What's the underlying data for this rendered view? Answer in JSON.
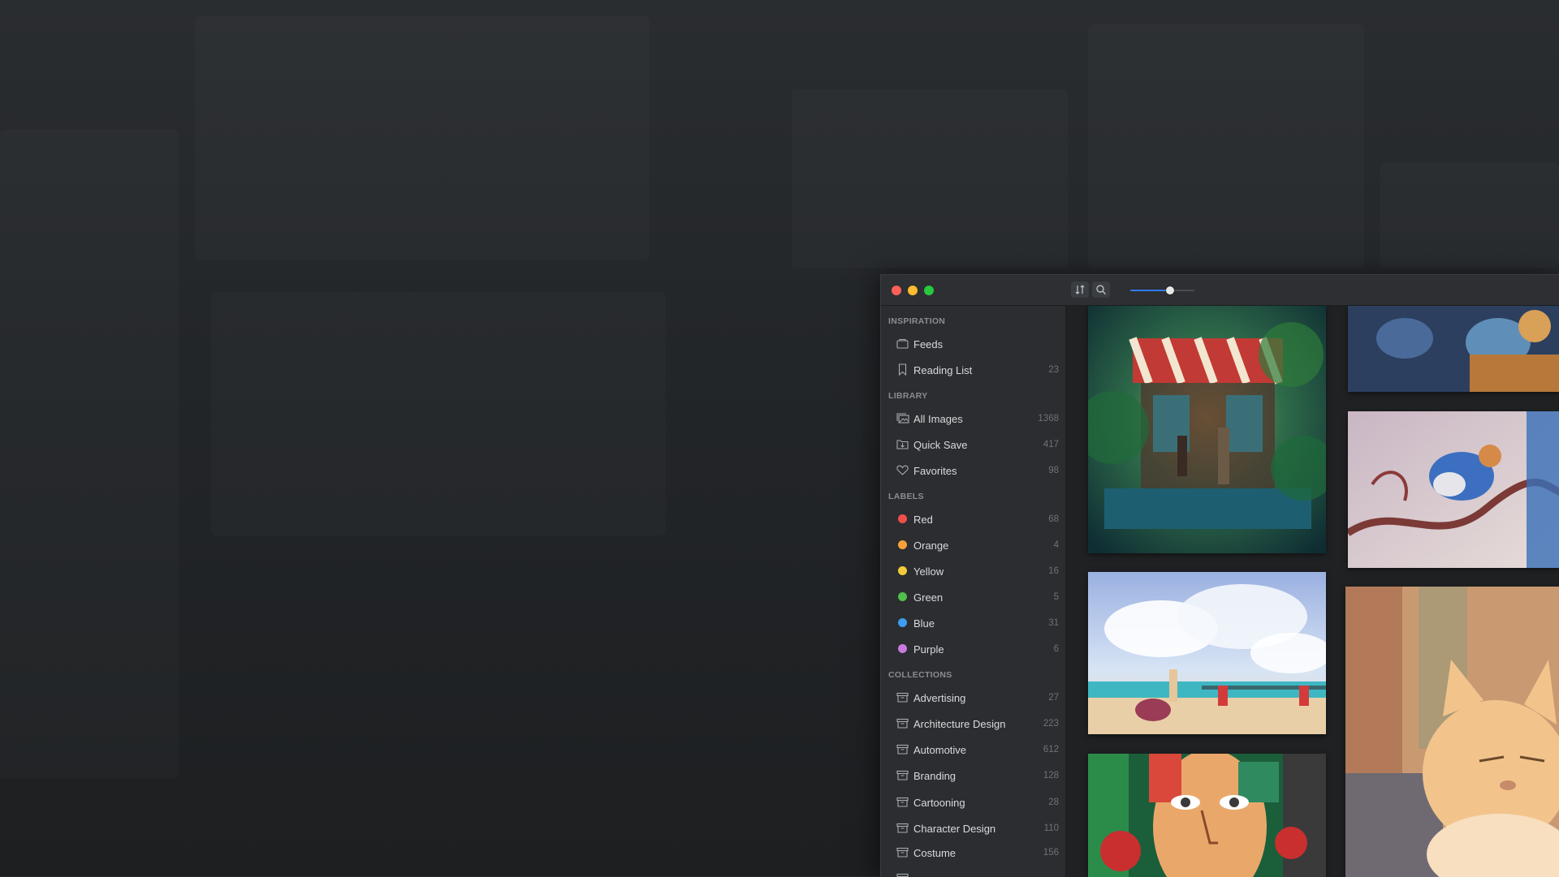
{
  "window": {
    "traffic_lights": [
      "close",
      "minimize",
      "zoom"
    ]
  },
  "toolbar": {
    "sort_icon": "sort-arrows-icon",
    "search_icon": "search-icon",
    "zoom_level": 0.62
  },
  "sidebar": {
    "sections": {
      "inspiration": "INSPIRATION",
      "library": "LIBRARY",
      "labels": "LABELS",
      "collections": "COLLECTIONS"
    },
    "inspiration": [
      {
        "label": "Feeds",
        "count": "",
        "icon": "feeds-icon"
      },
      {
        "label": "Reading List",
        "count": "23",
        "icon": "bookmark-icon"
      }
    ],
    "library": [
      {
        "label": "All Images",
        "count": "1368",
        "icon": "images-icon"
      },
      {
        "label": "Quick Save",
        "count": "417",
        "icon": "quick-save-icon"
      },
      {
        "label": "Favorites",
        "count": "98",
        "icon": "heart-icon"
      }
    ],
    "labels": [
      {
        "label": "Red",
        "count": "68",
        "color": "#ef4f4a"
      },
      {
        "label": "Orange",
        "count": "4",
        "color": "#f6a03a"
      },
      {
        "label": "Yellow",
        "count": "16",
        "color": "#f3cb3a"
      },
      {
        "label": "Green",
        "count": "5",
        "color": "#4fc04a"
      },
      {
        "label": "Blue",
        "count": "31",
        "color": "#3d9cf0"
      },
      {
        "label": "Purple",
        "count": "6",
        "color": "#c97ae0"
      }
    ],
    "collections": [
      {
        "label": "Advertising",
        "count": "27"
      },
      {
        "label": "Architecture Design",
        "count": "223"
      },
      {
        "label": "Automotive",
        "count": "612"
      },
      {
        "label": "Branding",
        "count": "128"
      },
      {
        "label": "Cartooning",
        "count": "28"
      },
      {
        "label": "Character Design",
        "count": "110"
      },
      {
        "label": "Costume",
        "count": "156"
      }
    ]
  }
}
